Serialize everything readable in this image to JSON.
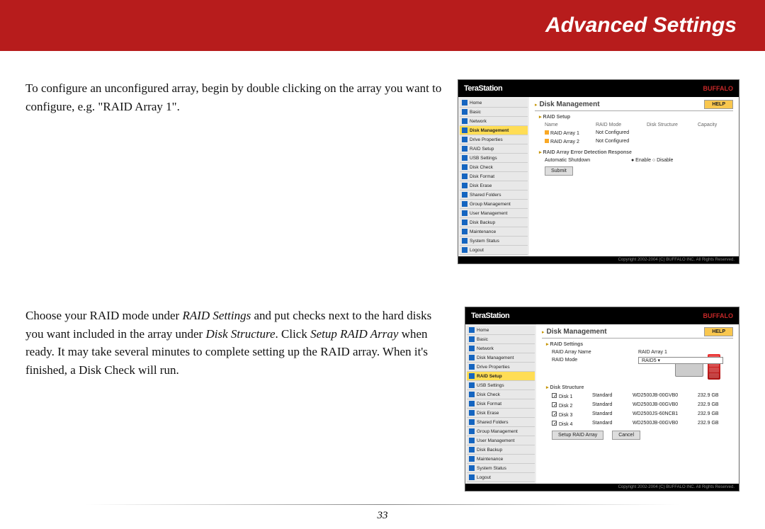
{
  "header": {
    "title": "Advanced Settings"
  },
  "para1_pre": "To configure an unconfigured array, begin by double clicking on the array you want to configure, e.g. \"RAID Array 1\".",
  "para2_a": "Choose your RAID mode under ",
  "para2_i1": "RAID Settings",
  "para2_b": " and put checks next to the hard disks you want included in the array under ",
  "para2_i2": "Disk Structure",
  "para2_c": ".  Click ",
  "para2_i3": "Setup RAID Array",
  "para2_d": " when ready.  It may take several minutes to complete  setting up the RAID array.  When it's finished, a Disk Check will run.",
  "page_number": "33",
  "ts": {
    "brand": "TeraStation",
    "buffalo": "BUFFALO",
    "help": "HELP",
    "main_title": "Disk Management",
    "footer": "Copyright 2002-2004 (C) BUFFALO INC. All Rights Reserved.",
    "nav": [
      "Home",
      "Basic",
      "Network",
      "Disk Management",
      "Drive Properties",
      "RAID Setup",
      "USB Settings",
      "Disk Check",
      "Disk Format",
      "Disk Erase",
      "Shared Folders",
      "Group Management",
      "User Management",
      "Disk Backup",
      "Maintenance",
      "System Status",
      "Logout"
    ],
    "nav_sel1": 3,
    "nav_sel2": 5
  },
  "shot1": {
    "sec1": "RAID Setup",
    "sec2": "RAID Array Error Detection Response",
    "cols": [
      "Name",
      "RAID Mode",
      "Disk Structure",
      "Capacity"
    ],
    "rows": [
      [
        "RAID Array 1",
        "Not Configured",
        "",
        ""
      ],
      [
        "RAID Array 2",
        "Not Configured",
        "",
        ""
      ]
    ],
    "resp_label": "Automatic Shutdown",
    "resp_opts": "● Enable  ○ Disable",
    "submit": "Submit"
  },
  "shot2": {
    "sec1": "RAID Settings",
    "sec2": "Disk Structure",
    "r_name_lbl": "RAID Array Name",
    "r_name_val": "RAID Array 1",
    "r_mode_lbl": "RAID Mode",
    "r_mode_val": "RAID5 ▾",
    "disks": [
      {
        "name": "Disk 1",
        "mode": "Standard",
        "model": "WD2500JB-00GVB0",
        "cap": "232.9 GB"
      },
      {
        "name": "Disk 2",
        "mode": "Standard",
        "model": "WD2500JB-00GVB0",
        "cap": "232.9 GB"
      },
      {
        "name": "Disk 3",
        "mode": "Standard",
        "model": "WD2500JS-60NCB1",
        "cap": "232.9 GB"
      },
      {
        "name": "Disk 4",
        "mode": "Standard",
        "model": "WD2500JB-00GVB0",
        "cap": "232.9 GB"
      }
    ],
    "btn1": "Setup RAID Array",
    "btn2": "Cancel"
  }
}
